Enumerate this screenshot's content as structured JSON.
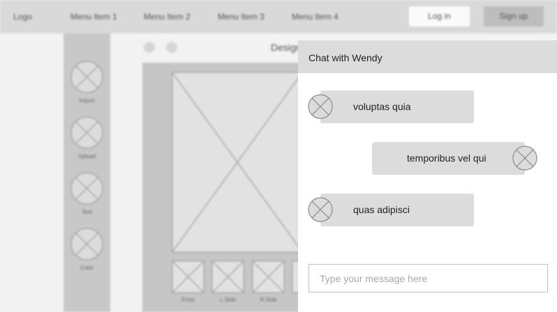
{
  "nav": {
    "logo": "Logo",
    "items": [
      "Menu Item 1",
      "Menu Item 2",
      "Menu Item 3",
      "Menu Item 4"
    ],
    "login": "Log in",
    "signup": "Sign up"
  },
  "tools": [
    {
      "label": "Import",
      "icon": "image-placeholder-icon"
    },
    {
      "label": "Upload",
      "icon": "image-placeholder-icon"
    },
    {
      "label": "Text",
      "icon": "image-placeholder-icon"
    },
    {
      "label": "Color",
      "icon": "image-placeholder-icon"
    }
  ],
  "design": {
    "title": "Design"
  },
  "views": [
    "Front",
    "L.Side",
    "R.Side"
  ],
  "chat": {
    "title": "Chat with Wendy",
    "messages": [
      {
        "from": "other",
        "text": "voluptas quia"
      },
      {
        "from": "self",
        "text": "temporibus vel qui"
      },
      {
        "from": "other",
        "text": "quas adipisci"
      }
    ],
    "input_placeholder": "Type your message here"
  },
  "colors": {
    "nav_bg": "#d9d9d9",
    "sidebar_bg": "#c8c8c8",
    "bubble_bg": "#dcdcdc",
    "panel_bg": "#ffffff"
  }
}
